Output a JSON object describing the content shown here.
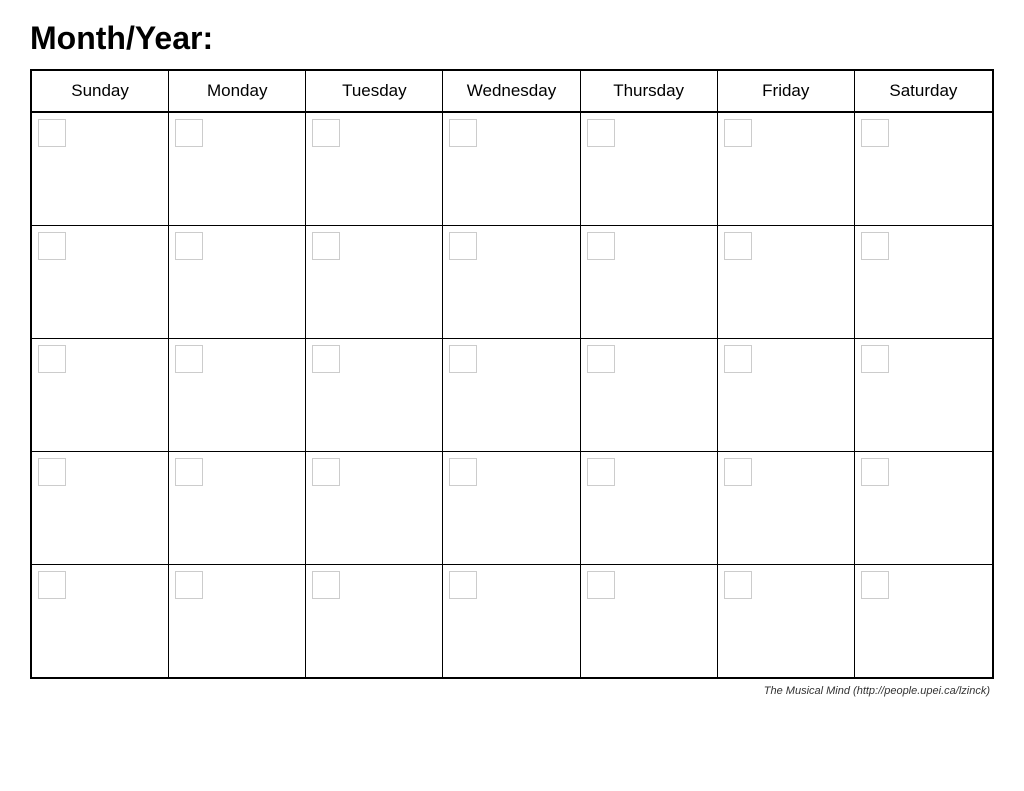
{
  "header": {
    "title": "Month/Year:"
  },
  "calendar": {
    "days": [
      "Sunday",
      "Monday",
      "Tuesday",
      "Wednesday",
      "Thursday",
      "Friday",
      "Saturday"
    ],
    "rows": 5
  },
  "footer": {
    "text": "The Musical Mind  (http://people.upei.ca/lzinck)"
  }
}
